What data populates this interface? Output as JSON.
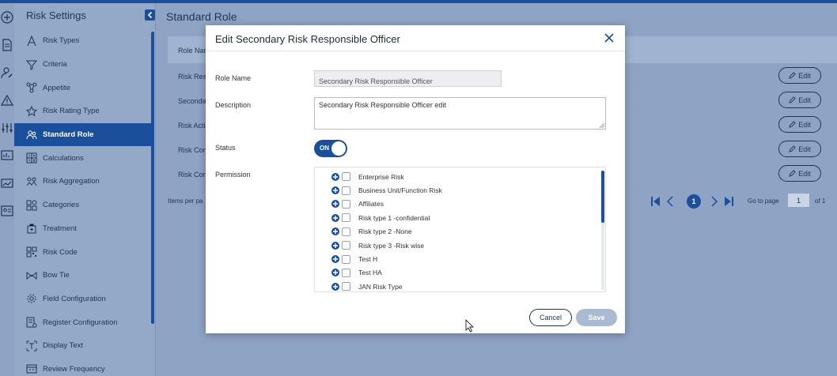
{
  "sidebar": {
    "title": "Risk Settings",
    "items": [
      {
        "label": "Risk Types",
        "icon": "ruler-compass-icon"
      },
      {
        "label": "Criteria",
        "icon": "filter-funnel-icon"
      },
      {
        "label": "Appetite",
        "icon": "network-icon"
      },
      {
        "label": "Risk Rating Type",
        "icon": "star-icon"
      },
      {
        "label": "Standard Role",
        "icon": "users-icon",
        "active": true
      },
      {
        "label": "Calculations",
        "icon": "calculator-icon"
      },
      {
        "label": "Risk Aggregation",
        "icon": "aggregation-icon"
      },
      {
        "label": "Categories",
        "icon": "categories-icon"
      },
      {
        "label": "Treatment",
        "icon": "treatment-icon"
      },
      {
        "label": "Risk Code",
        "icon": "qr-code-icon"
      },
      {
        "label": "Bow Tie",
        "icon": "bow-tie-icon"
      },
      {
        "label": "Field Configuration",
        "icon": "gear-icon"
      },
      {
        "label": "Register Configuration",
        "icon": "register-config-icon"
      },
      {
        "label": "Display Text",
        "icon": "display-text-icon"
      },
      {
        "label": "Review Frequency",
        "icon": "calendar-icon"
      }
    ]
  },
  "main": {
    "title": "Standard Role",
    "table": {
      "header": "Role Nam",
      "rows": [
        "Risk Resp",
        "Seconda",
        "Risk Acti",
        "Risk Con",
        "Risk Con"
      ],
      "edit_label": "Edit"
    },
    "pagination": {
      "items_per_page": "Items per pa",
      "current_page": "1",
      "goto_label": "Go to page",
      "goto_value": "1",
      "of_total": "of 1"
    }
  },
  "modal": {
    "title": "Edit Secondary Risk Responsible Officer",
    "role_name_label": "Role Name",
    "role_name_value": "Secondary Risk Responsible Officer",
    "description_label": "Description",
    "description_value": "Secondary Risk Responsible Officer edit",
    "status_label": "Status",
    "status_value": "ON",
    "permission_label": "Permission",
    "permissions": [
      "Enterprise Risk",
      "Business Unit/Function Risk",
      "Affiliates",
      "Risk type 1 -confidential",
      "Risk type 2 -None",
      "Risk type 3 -Risk wise",
      "Test H",
      "Test HA",
      "JAN Risk Type"
    ],
    "cancel_label": "Cancel",
    "save_label": "Save"
  },
  "colors": {
    "accent": "#1b4f9c",
    "overlay_bg": "#8fa4c4",
    "save_disabled": "#a9bad4"
  }
}
